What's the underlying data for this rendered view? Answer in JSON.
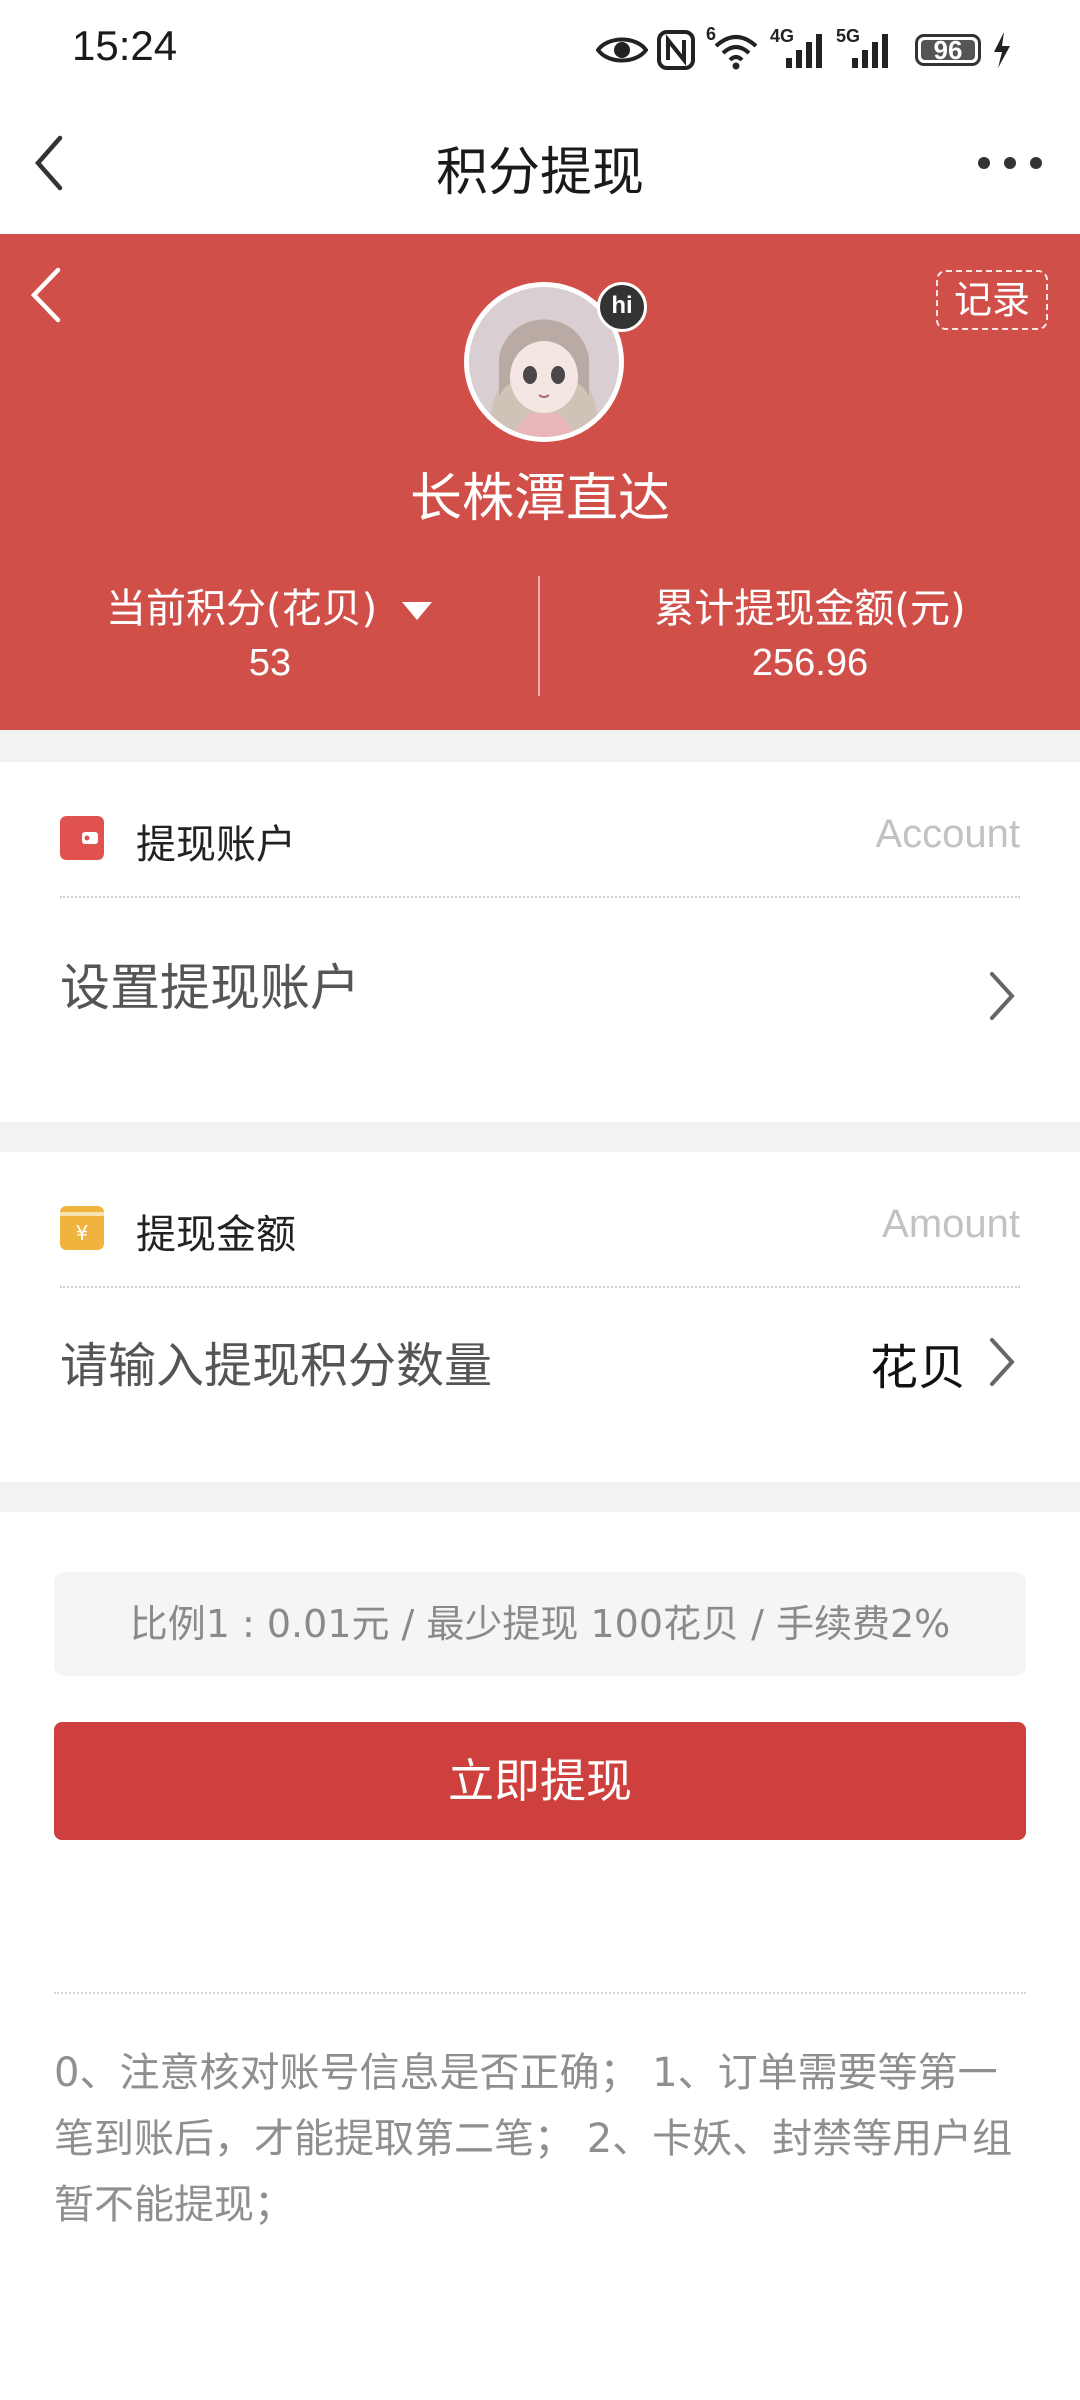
{
  "status_bar": {
    "time": "15:24",
    "network_1": "4G",
    "network_2": "5G",
    "wifi_badge": "6",
    "battery_level": "96"
  },
  "nav": {
    "title": "积分提现"
  },
  "profile": {
    "username": "长株潭直达",
    "avatar_badge": "hi",
    "record_label": "记录",
    "current_points_label": "当前积分(花贝)",
    "current_points_value": "53",
    "total_withdrawn_label": "累计提现金额(元)",
    "total_withdrawn_value": "256.96"
  },
  "account_section": {
    "title": "提现账户",
    "hint": "Account",
    "row_text": "设置提现账户"
  },
  "amount_section": {
    "title": "提现金额",
    "hint": "Amount",
    "input_placeholder": "请输入提现积分数量",
    "unit": "花贝"
  },
  "ratio_text": "比例1 : 0.01元 / 最少提现 100花贝 / 手续费2%",
  "withdraw_button": "立即提现",
  "notes": "0、注意核对账号信息是否正确； 1、订单需要等第一笔到账后，才能提取第二笔； 2、卡妖、封禁等用户组暂不能提现；",
  "colors": {
    "header_red": "#d05049",
    "button_red": "#cd403d",
    "wallet_icon": "#e0524f",
    "money_icon": "#f0b33d"
  },
  "icons": [
    "eye-icon",
    "nfc-icon",
    "wifi-icon",
    "signal-icon",
    "battery-icon",
    "charging-icon",
    "back-icon",
    "more-icon",
    "wallet-icon",
    "money-icon",
    "chevron-right-icon",
    "dropdown-icon"
  ]
}
